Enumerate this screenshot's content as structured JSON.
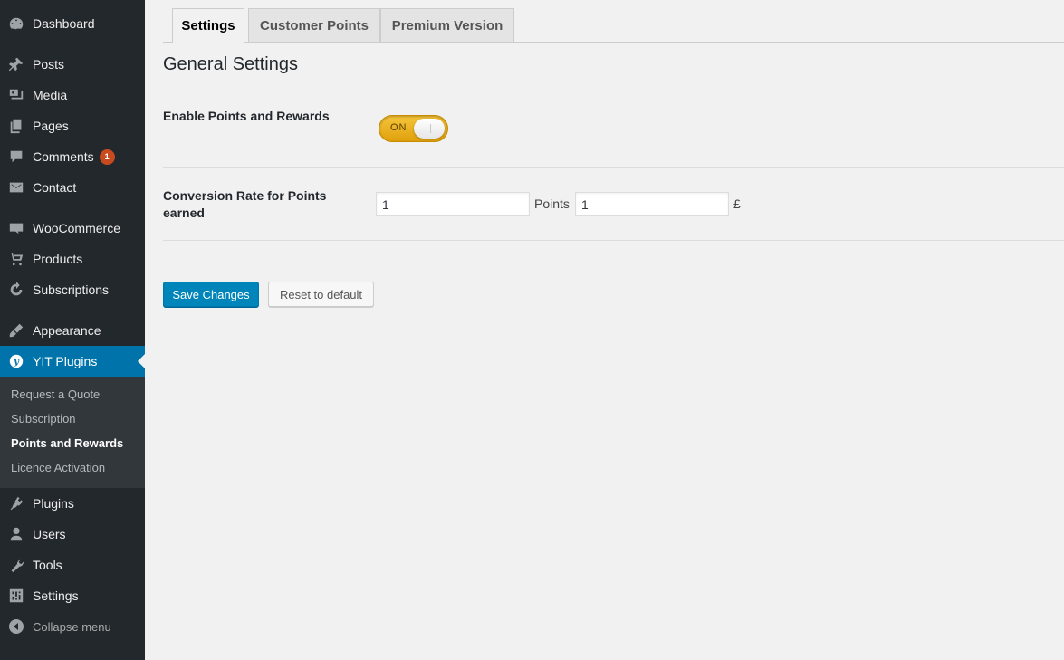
{
  "sidebar": {
    "items": [
      {
        "label": "Dashboard",
        "icon": "dashboard-icon"
      },
      {
        "label": "Posts",
        "icon": "pin-icon"
      },
      {
        "label": "Media",
        "icon": "media-icon"
      },
      {
        "label": "Pages",
        "icon": "pages-icon"
      },
      {
        "label": "Comments",
        "icon": "comment-icon",
        "badge": "1"
      },
      {
        "label": "Contact",
        "icon": "mail-icon"
      },
      {
        "label": "WooCommerce",
        "icon": "woocommerce-icon"
      },
      {
        "label": "Products",
        "icon": "cart-icon"
      },
      {
        "label": "Subscriptions",
        "icon": "refresh-icon"
      },
      {
        "label": "Appearance",
        "icon": "paintbrush-icon"
      },
      {
        "label": "YIT Plugins",
        "icon": "yit-icon"
      },
      {
        "label": "Plugins",
        "icon": "plug-icon"
      },
      {
        "label": "Users",
        "icon": "user-icon"
      },
      {
        "label": "Tools",
        "icon": "wrench-icon"
      },
      {
        "label": "Settings",
        "icon": "sliders-icon"
      }
    ],
    "submenu": [
      "Request a Quote",
      "Subscription",
      "Points and Rewards",
      "Licence Activation"
    ],
    "collapse_label": "Collapse menu"
  },
  "tabs": [
    "Settings",
    "Customer Points",
    "Premium Version"
  ],
  "section_title": "General Settings",
  "fields": {
    "enable_label": "Enable Points and Rewards",
    "toggle_text": "ON",
    "conversion_label_line1": "Conversion Rate for Points",
    "conversion_label_line2": "earned",
    "points_value": "1",
    "points_unit": "Points",
    "currency_value": "1",
    "currency_symbol": "£"
  },
  "buttons": {
    "save": "Save Changes",
    "reset": "Reset to default"
  },
  "colors": {
    "sidebar_bg": "#23282d",
    "active_menu": "#0073aa",
    "primary_button": "#0085ba",
    "toggle_on": "#f5c43a"
  }
}
